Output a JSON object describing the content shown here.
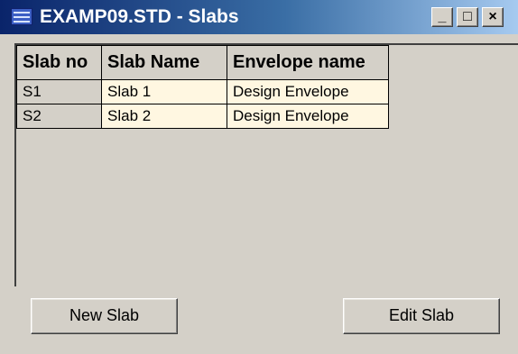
{
  "window": {
    "title": "EXAMP09.STD - Slabs",
    "controls": {
      "minimize": "_",
      "maximize": "□",
      "close": "×"
    },
    "icon": "table-window-icon"
  },
  "grid": {
    "columns": [
      "Slab no",
      "Slab Name",
      "Envelope name"
    ],
    "rows": [
      {
        "slab_no": "S1",
        "slab_name": "Slab 1",
        "envelope": "Design Envelope"
      },
      {
        "slab_no": "S2",
        "slab_name": "Slab 2",
        "envelope": "Design Envelope"
      }
    ]
  },
  "buttons": {
    "new": "New Slab",
    "edit": "Edit Slab"
  },
  "colors": {
    "window_bg": "#d4d0c8",
    "cell_bg": "#fff7e1",
    "titlebar_start": "#0a246a",
    "titlebar_end": "#a6caf0"
  }
}
